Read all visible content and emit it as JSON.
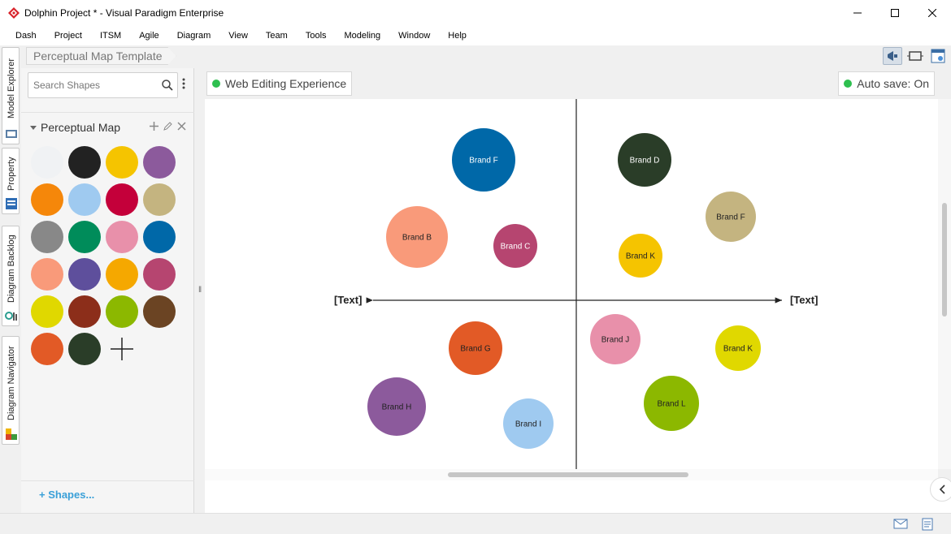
{
  "window": {
    "title": "Dolphin Project * - Visual Paradigm Enterprise",
    "controls": [
      "minimize-icon",
      "maximize-icon",
      "close-icon"
    ]
  },
  "menu": [
    "Dash",
    "Project",
    "ITSM",
    "Agile",
    "Diagram",
    "View",
    "Team",
    "Tools",
    "Modeling",
    "Window",
    "Help"
  ],
  "side_tabs": [
    "Model Explorer",
    "Property",
    "Diagram Backlog",
    "Diagram Navigator"
  ],
  "breadcrumb": "Perceptual Map Template",
  "shapes_panel": {
    "search_placeholder": "Search Shapes",
    "group_title": "Perceptual Map",
    "swatch_colors": [
      "#f0f2f4",
      "#222222",
      "#f5c400",
      "#8c5a9c",
      "#f5870a",
      "#9fcaf0",
      "#c4003a",
      "#c4b480",
      "#888888",
      "#008c5a",
      "#e890aa",
      "#0068a8",
      "#f99a7a",
      "#5e4f9c",
      "#f5a800",
      "#b64570",
      "#e0d800",
      "#8c2e1a",
      "#8cb800",
      "#6b4423",
      "#e25a26",
      "#2a3d28"
    ],
    "extra_shape": "axis-cross-icon",
    "more_link": "Shapes..."
  },
  "diagram_header": {
    "web_editing": "Web Editing Experience",
    "autosave": "Auto save: On",
    "status_color": "#2ebf4f"
  },
  "chart_data": {
    "type": "perceptual-map",
    "x_axis_labels": [
      "[Text]",
      "[Text]"
    ],
    "brands": [
      {
        "name": "Brand F",
        "color": "#0068a8",
        "label_color": "#ffffff"
      },
      {
        "name": "Brand D",
        "color": "#2a3d28",
        "label_color": "#ffffff"
      },
      {
        "name": "Brand F",
        "color": "#c4b480",
        "label_color": "#222222"
      },
      {
        "name": "Brand B",
        "color": "#f99a7a",
        "label_color": "#222222"
      },
      {
        "name": "Brand C",
        "color": "#b64570",
        "label_color": "#ffffff"
      },
      {
        "name": "Brand K",
        "color": "#f5c400",
        "label_color": "#222222"
      },
      {
        "name": "Brand J",
        "color": "#e890aa",
        "label_color": "#222222"
      },
      {
        "name": "Brand K",
        "color": "#e0d800",
        "label_color": "#222222"
      },
      {
        "name": "Brand G",
        "color": "#e25a26",
        "label_color": "#222222"
      },
      {
        "name": "Brand H",
        "color": "#8c5a9c",
        "label_color": "#222222"
      },
      {
        "name": "Brand L",
        "color": "#8cb800",
        "label_color": "#222222"
      },
      {
        "name": "Brand I",
        "color": "#9fcaf0",
        "label_color": "#222222"
      }
    ]
  },
  "status_icons": [
    "mail-icon",
    "note-icon"
  ]
}
